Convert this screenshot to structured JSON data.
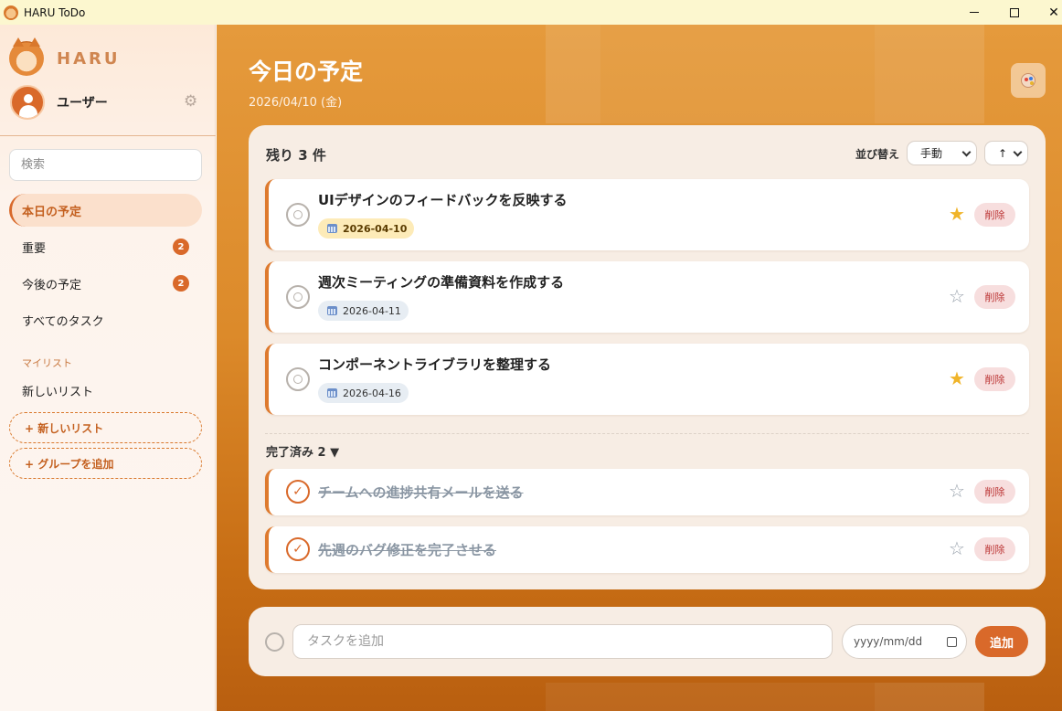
{
  "window": {
    "title": "HARU ToDo",
    "minimize_symbol": "",
    "maximize_symbol": "",
    "close_symbol": "✕"
  },
  "sidebar": {
    "brand": "HARU",
    "user_name": "ユーザー",
    "settings_icon": "⚙",
    "search_placeholder": "検索",
    "nav": [
      {
        "label": "本日の予定",
        "badge": ""
      },
      {
        "label": "重要",
        "badge": "2"
      },
      {
        "label": "今後の予定",
        "badge": "2"
      },
      {
        "label": "すべてのタスク",
        "badge": ""
      }
    ],
    "my_lists_label": "マイリスト",
    "lists": [
      {
        "label": "新しいリスト"
      }
    ],
    "new_list_button": "+ 新しいリスト",
    "add_group_button": "+ グループを追加"
  },
  "main": {
    "title": "今日の予定",
    "date": "2026/04/10 (金)",
    "remaining": "残り 3 件",
    "sort_label": "並び替え",
    "sort_value": "手動",
    "order_value": "↑",
    "open_tasks": [
      {
        "title": "UIデザインのフィードバックを反映する",
        "date": "2026-04-10",
        "starred": "★",
        "delete": "削除"
      },
      {
        "title": "週次ミーティングの準備資料を作成する",
        "date": "2026-04-11",
        "starred": "☆",
        "delete": "削除"
      },
      {
        "title": "コンポーネントライブラリを整理する",
        "date": "2026-04-16",
        "starred": "★",
        "delete": "削除"
      }
    ],
    "completed_header": "完了済み 2 ▼",
    "completed_tasks": [
      {
        "title": "チームへの進捗共有メールを送る",
        "check": "✓",
        "starred": "☆",
        "delete": "削除"
      },
      {
        "title": "先週のバグ修正を完了させる",
        "check": "✓",
        "starred": "☆",
        "delete": "削除"
      }
    ],
    "add_placeholder": "タスクを追加",
    "date_placeholder": "yyyy/mm/dd",
    "add_button": "追加"
  },
  "colors": {
    "accent": "#d9692a",
    "star": "#f0b429",
    "titlebar": "#fcf7cf"
  }
}
